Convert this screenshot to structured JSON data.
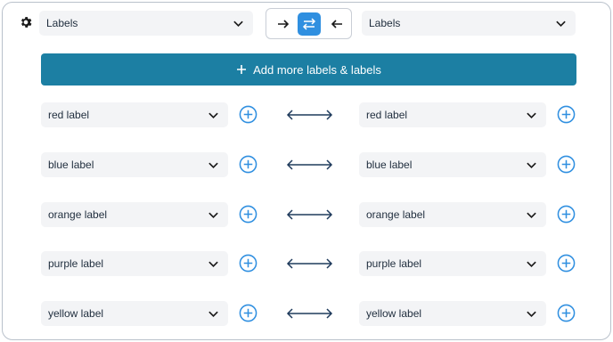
{
  "header": {
    "left_select": "Labels",
    "right_select": "Labels",
    "direction_buttons": [
      "→",
      "⇄",
      "←"
    ],
    "active_direction": 1
  },
  "add_button": {
    "label": "Add more labels & labels"
  },
  "mappings": [
    {
      "left": "red label",
      "right": "red label"
    },
    {
      "left": "blue label",
      "right": "blue label"
    },
    {
      "left": "orange label",
      "right": "orange label"
    },
    {
      "left": "purple label",
      "right": "purple label"
    },
    {
      "left": "yellow label",
      "right": "yellow label"
    }
  ],
  "colors": {
    "accent": "#2f8fe0",
    "add_bar": "#1c7fa3",
    "arrow": "#1f3b5c"
  }
}
